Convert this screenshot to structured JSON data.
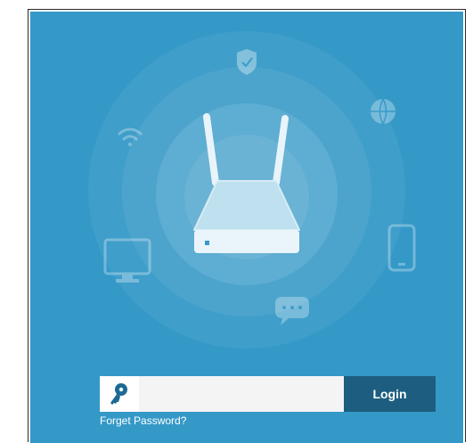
{
  "login": {
    "password_value": "",
    "password_placeholder": "",
    "button_label": "Login",
    "forget_label": "Forget Password?"
  },
  "icons": {
    "key": "key-icon",
    "router": "router-icon",
    "shield": "shield-icon",
    "wifi": "wifi-icon",
    "globe": "globe-icon",
    "monitor": "monitor-icon",
    "phone": "phone-icon",
    "chat": "chat-icon"
  },
  "colors": {
    "background": "#3599c8",
    "button": "#1d5e80",
    "key": "#1d6a94"
  }
}
